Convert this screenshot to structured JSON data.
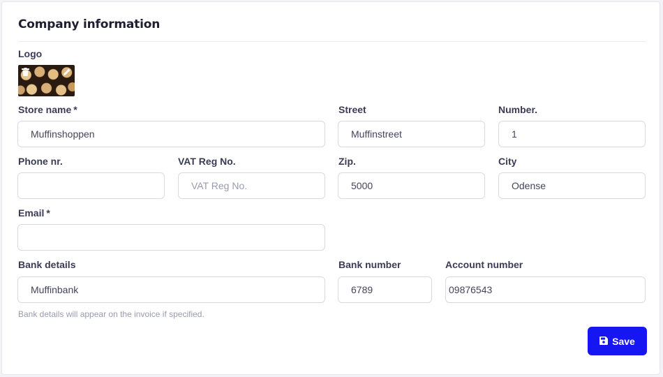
{
  "title": "Company information",
  "logo": {
    "label": "Logo"
  },
  "fields": {
    "store_name": {
      "label": "Store name",
      "required": "*",
      "value": "Muffinshoppen",
      "placeholder": ""
    },
    "street": {
      "label": "Street",
      "value": "Muffinstreet",
      "placeholder": ""
    },
    "number": {
      "label": "Number.",
      "value": "1",
      "placeholder": ""
    },
    "phone": {
      "label": "Phone nr.",
      "value": "",
      "placeholder": ""
    },
    "vat": {
      "label": "VAT Reg No.",
      "value": "",
      "placeholder": "VAT Reg No."
    },
    "zip": {
      "label": "Zip.",
      "value": "5000",
      "placeholder": ""
    },
    "city": {
      "label": "City",
      "value": "Odense",
      "placeholder": ""
    },
    "email": {
      "label": "Email",
      "required": "*",
      "value": "",
      "placeholder": ""
    },
    "bank_details": {
      "label": "Bank details",
      "value": "Muffinbank",
      "placeholder": ""
    },
    "bank_number": {
      "label": "Bank number",
      "value": "6789",
      "placeholder": ""
    },
    "account_number": {
      "label": "Account number",
      "value": "09876543",
      "placeholder": ""
    }
  },
  "help_text": "Bank details will appear on the invoice if specified.",
  "save_label": "Save",
  "colors": {
    "accent": "#1616f2",
    "border": "#d9d9e3",
    "label": "#3b3b55"
  }
}
